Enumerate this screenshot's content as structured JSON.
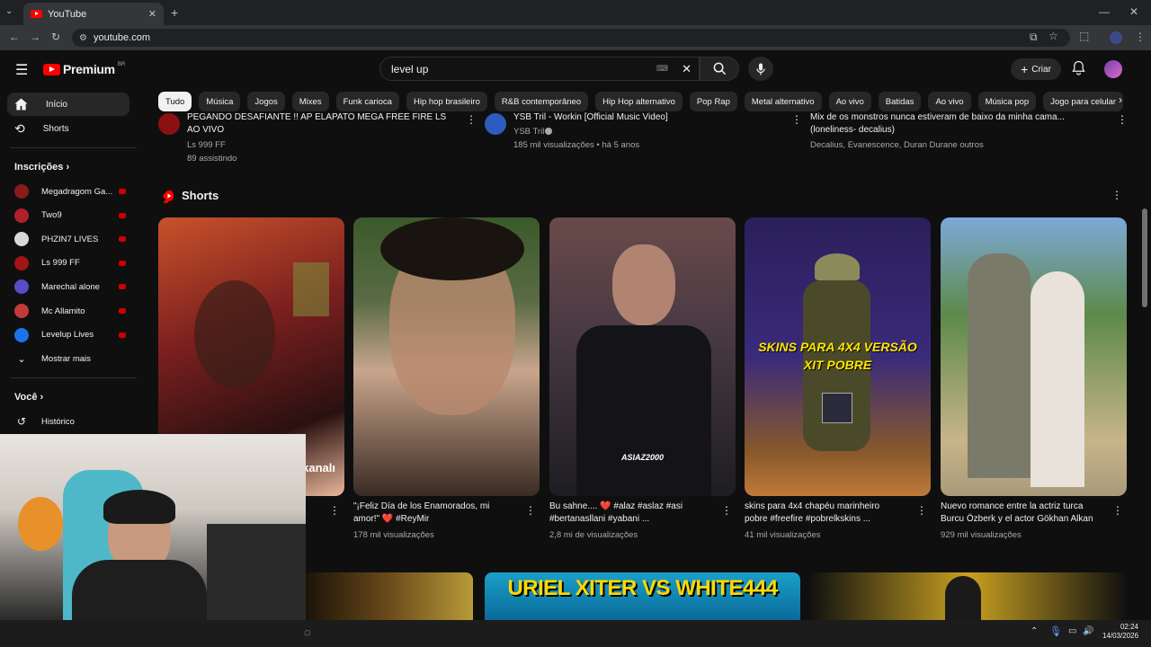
{
  "browser": {
    "tab_title": "YouTube",
    "new_tab": "+",
    "url": "youtube.com"
  },
  "header": {
    "logo_text": "Premium",
    "logo_region": "BR",
    "search_value": "level up",
    "create_label": "Criar"
  },
  "chips": [
    "Tudo",
    "Música",
    "Jogos",
    "Mixes",
    "Funk carioca",
    "Hip hop brasileiro",
    "R&B contemporâneo",
    "Hip Hop alternativo",
    "Pop Rap",
    "Metal alternativo",
    "Ao vivo",
    "Batidas",
    "Ao vivo",
    "Música pop",
    "Jogo para celular"
  ],
  "sidebar": {
    "home": "Início",
    "shorts": "Shorts",
    "subscriptions_heading": "Inscrições",
    "subscriptions": [
      {
        "name": "Megadragom Ga...",
        "color": "#8b1a1a"
      },
      {
        "name": "Two9",
        "color": "#b0202a"
      },
      {
        "name": "PHZIN7 LIVES",
        "color": "#d8d8d8"
      },
      {
        "name": "Ls 999 FF",
        "color": "#a11515"
      },
      {
        "name": "Marechal alone",
        "color": "#5a4cc7"
      },
      {
        "name": "Mc Allamito",
        "color": "#c43a3a"
      },
      {
        "name": "Levelup Lives",
        "color": "#1a73e8"
      }
    ],
    "show_more": "Mostrar mais",
    "you_heading": "Você",
    "history": "Histórico"
  },
  "top_row": [
    {
      "title": "PEGANDO DESAFIANTE !! AP ELAPATO MEGA FREE FIRE LS AO VIVO",
      "channel": "Ls 999 FF",
      "meta": "89 assistindo"
    },
    {
      "title": "YSB Tril - Workin [Official Music Video]",
      "channel": "YSB Tril",
      "meta": "185 mil visualizações • há 5 anos"
    },
    {
      "title": "Mix de os monstros nunca estiveram de baixo da minha cama... (loneliness- decalius)",
      "channel": "Decalius, Evanescence, Duran Durane outros",
      "meta": ""
    }
  ],
  "shorts": {
    "heading": "Shorts",
    "items": [
      {
        "title": "",
        "views": "",
        "overlay": "kanalı"
      },
      {
        "title": "\"¡Feliz Día de los Enamorados, mi amor!\" ❤️ #ReyMir",
        "views": "178 mil visualizações",
        "overlay": ""
      },
      {
        "title": "Bu sahne.... ❤️ #alaz #aslaz #asi #bertanasllani #yabani ...",
        "views": "2,8 mi de visualizações",
        "overlay": "ASIAZ2000"
      },
      {
        "title": "skins para 4x4 chapéu marinheiro pobre #freefire #pobrelkskins ...",
        "views": "41 mil visualizações",
        "overlay": "SKINS PARA 4X4 VERSÃO XIT POBRE"
      },
      {
        "title": "Nuevo romance entre la actriz turca Burcu Özberk y el actor Gökhan Alkan",
        "views": "929 mil visualizações",
        "overlay": ""
      }
    ]
  },
  "bottom_thumb_text": "URIEL XITER VS WHITE444",
  "taskbar": {
    "time": "02:24",
    "date": "14/03/2026"
  },
  "colors": {
    "bg": "#0f0f0f",
    "accent_red": "#ff0000",
    "chip_bg": "#272727"
  }
}
